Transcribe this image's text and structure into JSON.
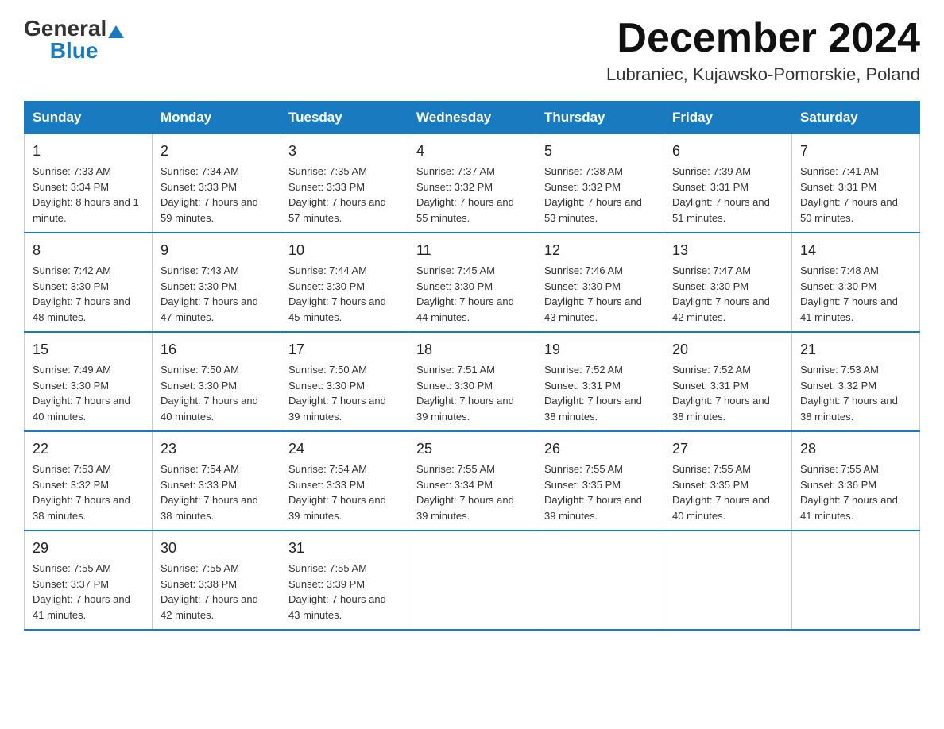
{
  "header": {
    "logo": {
      "text1": "General",
      "text2": "Blue"
    },
    "month_title": "December 2024",
    "location": "Lubraniec, Kujawsko-Pomorskie, Poland"
  },
  "days_of_week": [
    "Sunday",
    "Monday",
    "Tuesday",
    "Wednesday",
    "Thursday",
    "Friday",
    "Saturday"
  ],
  "weeks": [
    [
      {
        "day": "1",
        "sunrise": "7:33 AM",
        "sunset": "3:34 PM",
        "daylight": "8 hours and 1 minute."
      },
      {
        "day": "2",
        "sunrise": "7:34 AM",
        "sunset": "3:33 PM",
        "daylight": "7 hours and 59 minutes."
      },
      {
        "day": "3",
        "sunrise": "7:35 AM",
        "sunset": "3:33 PM",
        "daylight": "7 hours and 57 minutes."
      },
      {
        "day": "4",
        "sunrise": "7:37 AM",
        "sunset": "3:32 PM",
        "daylight": "7 hours and 55 minutes."
      },
      {
        "day": "5",
        "sunrise": "7:38 AM",
        "sunset": "3:32 PM",
        "daylight": "7 hours and 53 minutes."
      },
      {
        "day": "6",
        "sunrise": "7:39 AM",
        "sunset": "3:31 PM",
        "daylight": "7 hours and 51 minutes."
      },
      {
        "day": "7",
        "sunrise": "7:41 AM",
        "sunset": "3:31 PM",
        "daylight": "7 hours and 50 minutes."
      }
    ],
    [
      {
        "day": "8",
        "sunrise": "7:42 AM",
        "sunset": "3:30 PM",
        "daylight": "7 hours and 48 minutes."
      },
      {
        "day": "9",
        "sunrise": "7:43 AM",
        "sunset": "3:30 PM",
        "daylight": "7 hours and 47 minutes."
      },
      {
        "day": "10",
        "sunrise": "7:44 AM",
        "sunset": "3:30 PM",
        "daylight": "7 hours and 45 minutes."
      },
      {
        "day": "11",
        "sunrise": "7:45 AM",
        "sunset": "3:30 PM",
        "daylight": "7 hours and 44 minutes."
      },
      {
        "day": "12",
        "sunrise": "7:46 AM",
        "sunset": "3:30 PM",
        "daylight": "7 hours and 43 minutes."
      },
      {
        "day": "13",
        "sunrise": "7:47 AM",
        "sunset": "3:30 PM",
        "daylight": "7 hours and 42 minutes."
      },
      {
        "day": "14",
        "sunrise": "7:48 AM",
        "sunset": "3:30 PM",
        "daylight": "7 hours and 41 minutes."
      }
    ],
    [
      {
        "day": "15",
        "sunrise": "7:49 AM",
        "sunset": "3:30 PM",
        "daylight": "7 hours and 40 minutes."
      },
      {
        "day": "16",
        "sunrise": "7:50 AM",
        "sunset": "3:30 PM",
        "daylight": "7 hours and 40 minutes."
      },
      {
        "day": "17",
        "sunrise": "7:50 AM",
        "sunset": "3:30 PM",
        "daylight": "7 hours and 39 minutes."
      },
      {
        "day": "18",
        "sunrise": "7:51 AM",
        "sunset": "3:30 PM",
        "daylight": "7 hours and 39 minutes."
      },
      {
        "day": "19",
        "sunrise": "7:52 AM",
        "sunset": "3:31 PM",
        "daylight": "7 hours and 38 minutes."
      },
      {
        "day": "20",
        "sunrise": "7:52 AM",
        "sunset": "3:31 PM",
        "daylight": "7 hours and 38 minutes."
      },
      {
        "day": "21",
        "sunrise": "7:53 AM",
        "sunset": "3:32 PM",
        "daylight": "7 hours and 38 minutes."
      }
    ],
    [
      {
        "day": "22",
        "sunrise": "7:53 AM",
        "sunset": "3:32 PM",
        "daylight": "7 hours and 38 minutes."
      },
      {
        "day": "23",
        "sunrise": "7:54 AM",
        "sunset": "3:33 PM",
        "daylight": "7 hours and 38 minutes."
      },
      {
        "day": "24",
        "sunrise": "7:54 AM",
        "sunset": "3:33 PM",
        "daylight": "7 hours and 39 minutes."
      },
      {
        "day": "25",
        "sunrise": "7:55 AM",
        "sunset": "3:34 PM",
        "daylight": "7 hours and 39 minutes."
      },
      {
        "day": "26",
        "sunrise": "7:55 AM",
        "sunset": "3:35 PM",
        "daylight": "7 hours and 39 minutes."
      },
      {
        "day": "27",
        "sunrise": "7:55 AM",
        "sunset": "3:35 PM",
        "daylight": "7 hours and 40 minutes."
      },
      {
        "day": "28",
        "sunrise": "7:55 AM",
        "sunset": "3:36 PM",
        "daylight": "7 hours and 41 minutes."
      }
    ],
    [
      {
        "day": "29",
        "sunrise": "7:55 AM",
        "sunset": "3:37 PM",
        "daylight": "7 hours and 41 minutes."
      },
      {
        "day": "30",
        "sunrise": "7:55 AM",
        "sunset": "3:38 PM",
        "daylight": "7 hours and 42 minutes."
      },
      {
        "day": "31",
        "sunrise": "7:55 AM",
        "sunset": "3:39 PM",
        "daylight": "7 hours and 43 minutes."
      },
      null,
      null,
      null,
      null
    ]
  ]
}
